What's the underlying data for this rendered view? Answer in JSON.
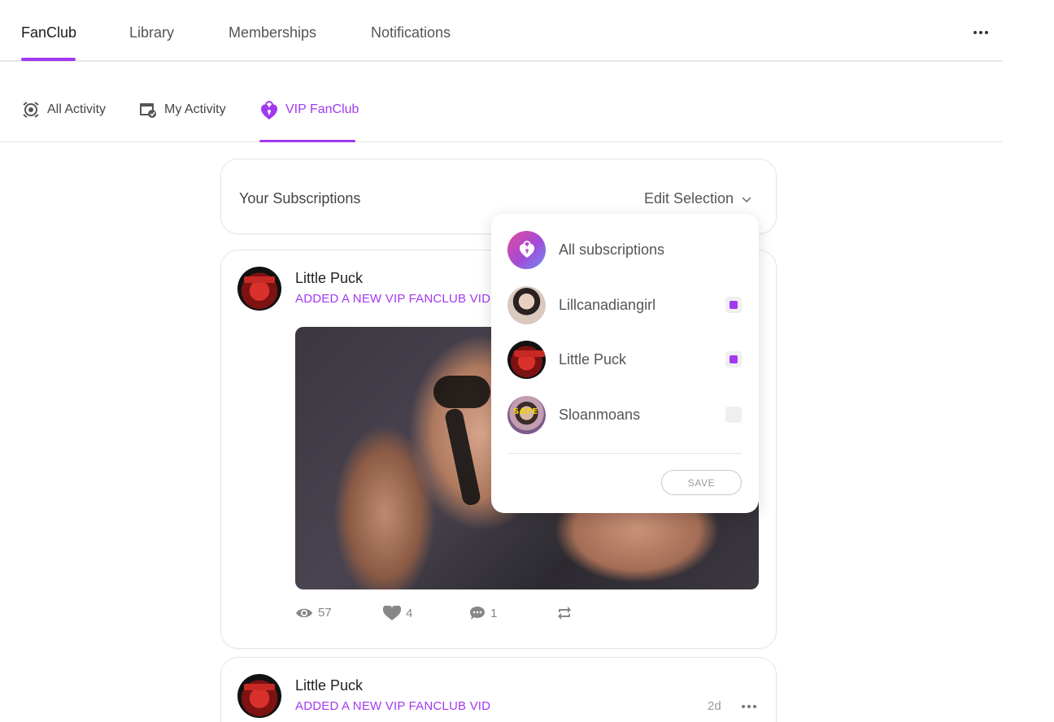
{
  "top_nav": {
    "tabs": [
      {
        "label": "FanClub",
        "active": true
      },
      {
        "label": "Library",
        "active": false
      },
      {
        "label": "Memberships",
        "active": false
      },
      {
        "label": "Notifications",
        "active": false
      }
    ],
    "more_icon": "more-horizontal-icon",
    "accent_color": "#a239f0"
  },
  "sub_nav": {
    "tabs": [
      {
        "label": "All Activity",
        "icon": "all-activity-icon",
        "active": false
      },
      {
        "label": "My Activity",
        "icon": "my-activity-icon",
        "active": false
      },
      {
        "label": "VIP FanClub",
        "icon": "vip-lock-heart-icon",
        "active": true
      }
    ]
  },
  "subscriptions": {
    "title": "Your Subscriptions",
    "edit_label": "Edit Selection"
  },
  "dropdown": {
    "items": [
      {
        "label": "All subscriptions",
        "checked": null
      },
      {
        "label": "Lillcanadiangirl",
        "checked": true
      },
      {
        "label": "Little Puck",
        "checked": true
      },
      {
        "label": "Sloanmoans",
        "checked": false
      }
    ],
    "save_label": "SAVE"
  },
  "posts": [
    {
      "author": "Little Puck",
      "action": "ADDED A NEW VIP FANCLUB VID",
      "stats": {
        "views": "57",
        "likes": "4",
        "comments": "1"
      }
    },
    {
      "author": "Little Puck",
      "action": "ADDED A NEW VIP FANCLUB VID",
      "time": "2d"
    }
  ]
}
